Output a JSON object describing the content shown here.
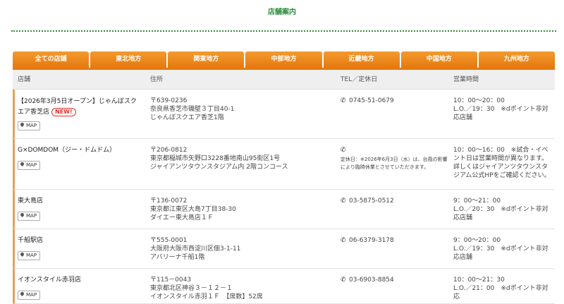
{
  "page": {
    "title": "店舗案内"
  },
  "tabs": [
    "全ての店舗",
    "東北地方",
    "関東地方",
    "中部地方",
    "近畿地方",
    "中国地方",
    "九州地方"
  ],
  "table": {
    "headers": [
      "店舗",
      "住所",
      "TEL／定休日",
      "営業時間"
    ],
    "map_label": "MAP",
    "new_label": "NEW!",
    "rows": [
      {
        "name": "【2026年3月5日オープン】じゃんぼスクエア香芝店",
        "address": [
          "〒639-0236",
          "奈良県香芝市磯壁３丁目40-1",
          "じゃんぼスクエア香芝1階"
        ],
        "tel": "0745-51-0679",
        "note": "",
        "hours": [
          "10：00～20：00",
          "L.O.／19：30　※dポイント非対応店舗"
        ]
      },
      {
        "name": "G×DOMDOM（ジー・ドムドム）",
        "address": [
          "〒206-0812",
          "東京都稲城市矢野口3228番地南山95街区1号",
          "ジャイアンツタウンスタジアム内 2階コンコース"
        ],
        "tel": "",
        "note": "定休日：※2026年6月3日（水）は、台風の影響により臨時休業とさせていただきます。",
        "hours": [
          "10：00～16：00　※試合・イベント日は営業時間が異なります。詳しくはジャイアンツタウンスタジアム公式HPをご確認ください。"
        ]
      },
      {
        "name": "東大島店",
        "address": [
          "〒136-0072",
          "東京都江東区大島7丁目38-30",
          "ダイエー東大島店１Ｆ"
        ],
        "tel": "03-5875-0512",
        "note": "",
        "hours": [
          "9：00～21：00",
          "L.O.／20：30　※dポイント非対応店舗"
        ]
      },
      {
        "name": "千船駅店",
        "address": [
          "〒555-0001",
          "大阪府大阪市西淀川区佃3-1-11",
          "アバリーナ千船1階"
        ],
        "tel": "06-6379-3178",
        "note": "",
        "hours": [
          "9：00～20：00",
          "L.O.／19：30　※dポイント非対応店舗"
        ]
      },
      {
        "name": "イオンスタイル赤羽店",
        "address": [
          "〒115－0043",
          "東京都北区神谷３－１２－１",
          "イオンスタイル赤羽１Ｆ　【席数】52席"
        ],
        "tel": "03-6903-8854",
        "note": "",
        "hours": [
          "10：00～21：30",
          "L.O.／21：00　※dポイント非対応"
        ]
      }
    ]
  }
}
